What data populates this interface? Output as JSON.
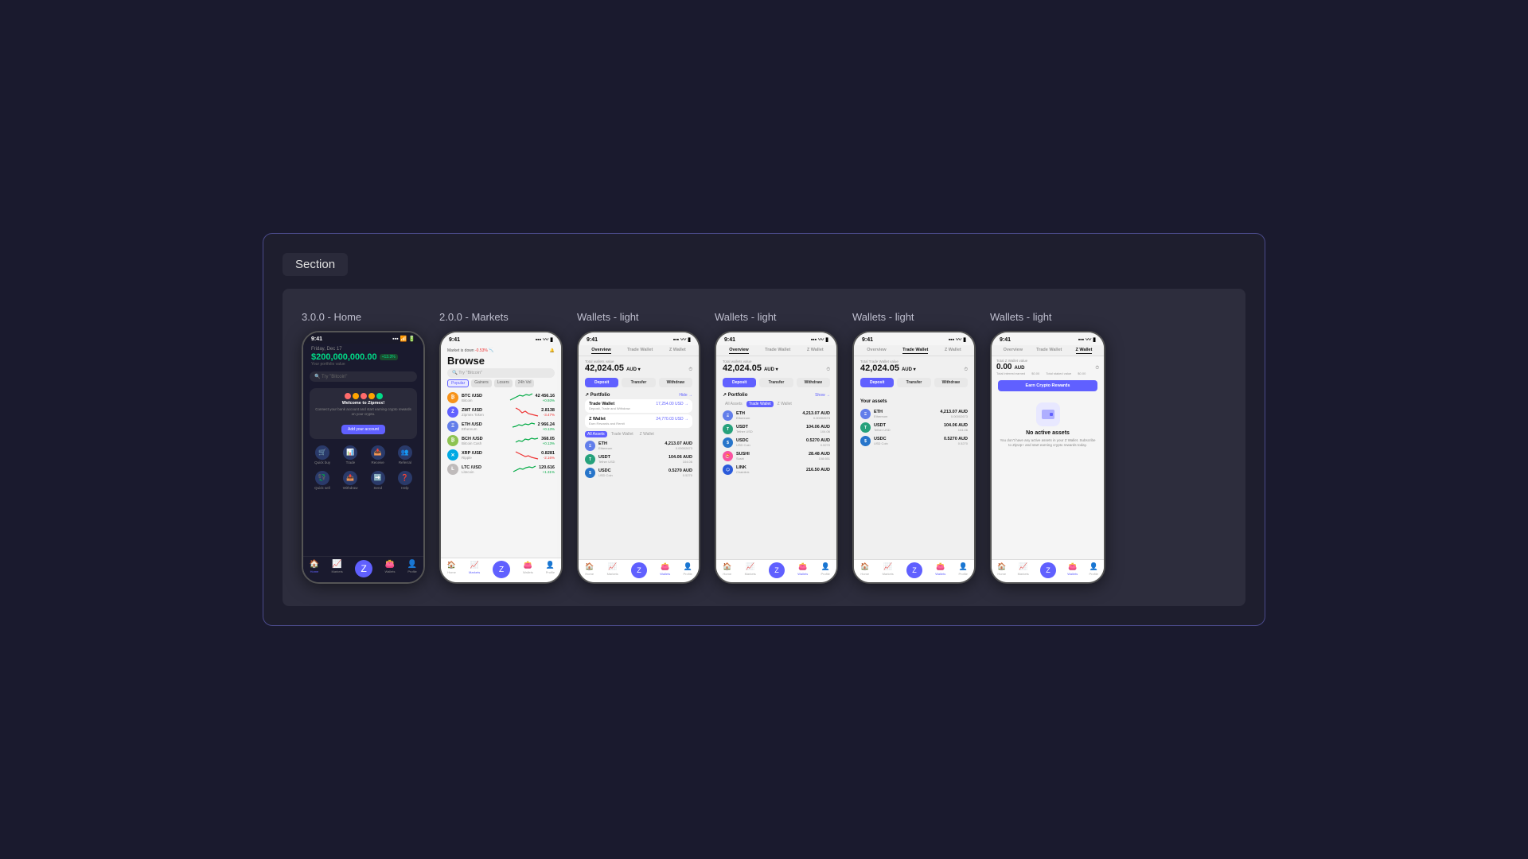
{
  "page": {
    "background": "#1a1a2e",
    "section_label": "Section"
  },
  "screens": [
    {
      "id": "home",
      "title": "3.0.0 - Home",
      "status_time": "9:41",
      "theme": "dark",
      "date": "Friday, Dec 17",
      "value": "$200,000,000.00",
      "badge": "+13.3%",
      "portfolio_label": "Your portfolio value",
      "search_placeholder": "Try \"Bitcoin\"",
      "logo_colors": [
        "#ff6b6b",
        "#ffa500",
        "#ff6b6b",
        "#ffa500",
        "#00dd88"
      ],
      "connect_title": "Welcome to Zipmex!",
      "connect_sub": "Connect your bank account and start earning crypto rewards on your crypto.",
      "add_btn": "Add your account",
      "actions": [
        "Quick buy",
        "Trade",
        "Receive",
        "Referral",
        "Quick sell",
        "Withdraw",
        "Send",
        "Help"
      ],
      "nav_items": [
        "Home",
        "Markets",
        "",
        "Wallets",
        "Profile"
      ],
      "nav_active": 0
    },
    {
      "id": "markets",
      "title": "2.0.0 - Markets",
      "status_time": "9:41",
      "theme": "light",
      "browse_title": "Browse",
      "market_alert": "Market is down -0.53%",
      "search_placeholder": "Try \"Bitcoin\"",
      "filter_tabs": [
        "Popular",
        "Gainers",
        "Losers",
        "24h Vol"
      ],
      "active_filter": 0,
      "coins": [
        {
          "pair": "BTC/USD",
          "name": "Bitcoin",
          "price": "42 456.16",
          "change": "+0.93%",
          "color": "#f7931a",
          "up": true
        },
        {
          "pair": "ZMT/USD",
          "name": "Zipmex Token",
          "price": "2.8138",
          "change": "-3.47%",
          "color": "#6060ff",
          "up": false
        },
        {
          "pair": "ETH/USD",
          "name": "Ethereum",
          "price": "2 966.24",
          "change": "+0.13%",
          "color": "#627eea",
          "up": true
        },
        {
          "pair": "BCH/USD",
          "name": "Bitcoin Cash",
          "price": "368.05",
          "change": "+0.13%",
          "color": "#8dc351",
          "up": true
        },
        {
          "pair": "XRP/USD",
          "name": "Ripple",
          "price": "0.8281",
          "change": "-2.16%",
          "color": "#00aae4",
          "up": false
        },
        {
          "pair": "LTC/USD",
          "name": "Litecoin",
          "price": "120.616",
          "change": "+1.31%",
          "color": "#bfbbbb",
          "up": true
        }
      ]
    },
    {
      "id": "wallets-overview",
      "title": "Wallets - light",
      "status_time": "9:41",
      "theme": "light",
      "tabs": [
        "Overview",
        "Trade Wallet",
        "Z Wallet"
      ],
      "active_tab": 0,
      "total_label": "Total wallets value",
      "total_value": "42,024.05",
      "currency": "AUD",
      "actions": [
        "Deposit",
        "Transfer",
        "Withdraw"
      ],
      "portfolio_section": "Portfolio",
      "hide_label": "Hide →",
      "sub_sections": [
        {
          "name": "Trade Wallet",
          "value": "17,254.00 USD →",
          "sub": "Deposit, Trade and Withdraw"
        },
        {
          "name": "Z Wallet",
          "value": "24,770.03 USD →",
          "sub": "Earn Rewards and Remit"
        }
      ],
      "asset_tabs": [
        "All Assets",
        "Trade Wallet",
        "Z Wallet"
      ],
      "active_asset_tab": 0,
      "assets": [
        {
          "symbol": "ETH",
          "name": "Ethereum",
          "aud": "4,213.07 AUD",
          "qty": "0.00002673",
          "color": "#627eea"
        },
        {
          "symbol": "USDT",
          "name": "Tether USD",
          "aud": "104.06 AUD",
          "qty": "104.06",
          "color": "#26a17b"
        },
        {
          "symbol": "USDC",
          "name": "USD Coin",
          "aud": "0.5270 AUD",
          "qty": "0.5270",
          "color": "#2775ca"
        }
      ]
    },
    {
      "id": "wallets-trade",
      "title": "Wallets - light",
      "status_time": "9:41",
      "theme": "light",
      "tabs": [
        "Overview",
        "Trade Wallet",
        "Z Wallet"
      ],
      "active_tab": 0,
      "total_label": "Total wallets value",
      "total_value": "42,024.05",
      "currency": "AUD",
      "actions": [
        "Deposit",
        "Transfer",
        "Withdraw"
      ],
      "portfolio_section": "Portfolio",
      "show_label": "Show →",
      "asset_tabs": [
        "All Assets",
        "Trade Wallet",
        "Z Wallet"
      ],
      "active_asset_tab": 1,
      "assets": [
        {
          "symbol": "ETH",
          "name": "Ethereum",
          "aud": "4,213.07 AUD",
          "qty": "0.00002673",
          "color": "#627eea"
        },
        {
          "symbol": "USDT",
          "name": "Tether USD",
          "aud": "104.06 AUD",
          "qty": "104.06",
          "color": "#26a17b"
        },
        {
          "symbol": "USDC",
          "name": "USD Coin",
          "aud": "0.5270 AUD",
          "qty": "0.5270",
          "color": "#2775ca"
        },
        {
          "symbol": "SUSHI",
          "name": "Sushi",
          "aud": "28.48 AUD",
          "qty": "108.651",
          "color": "#fa52a0"
        },
        {
          "symbol": "LINK",
          "name": "Chainlink",
          "aud": "216.50 AUD",
          "qty": "",
          "color": "#2a5ada"
        }
      ]
    },
    {
      "id": "wallets-zwallet-active",
      "title": "Wallets - light",
      "status_time": "9:41",
      "theme": "light",
      "tabs": [
        "Overview",
        "Trade Wallet",
        "Z Wallet"
      ],
      "active_tab": 1,
      "total_label": "Total Trade Wallet value",
      "total_value": "42,024.05",
      "currency": "AUD",
      "actions": [
        "Deposit",
        "Transfer",
        "Withdraw"
      ],
      "your_assets_label": "Your assets",
      "assets": [
        {
          "symbol": "ETH",
          "name": "Ethereum",
          "aud": "4,213.07 AUD",
          "qty": "0.00002673",
          "color": "#627eea"
        },
        {
          "symbol": "USDT",
          "name": "Tether USD",
          "aud": "104.06 AUD",
          "qty": "104.06",
          "color": "#26a17b"
        },
        {
          "symbol": "USDC",
          "name": "USD Coin",
          "aud": "0.5270 AUD",
          "qty": "0.5270",
          "color": "#2775ca"
        }
      ]
    },
    {
      "id": "wallets-empty",
      "title": "Wallets - light",
      "status_time": "9:41",
      "theme": "light",
      "tabs": [
        "Overview",
        "Trade Wallet",
        "Z Wallet"
      ],
      "active_tab": 2,
      "total_label": "Total Z Wallet value",
      "total_value": "0.00",
      "currency": "AUD",
      "interest_label": "Total interest earned",
      "interest_value": "$0.00",
      "staked_label": "Total staked value",
      "staked_value": "$0.00",
      "earn_btn": "Earn Crypto Rewards",
      "no_assets_title": "No active assets",
      "no_assets_text": "You don't have any active assets in your Z Wallet. Subscribe to ZipUp+ and start earning crypto rewards today."
    }
  ]
}
